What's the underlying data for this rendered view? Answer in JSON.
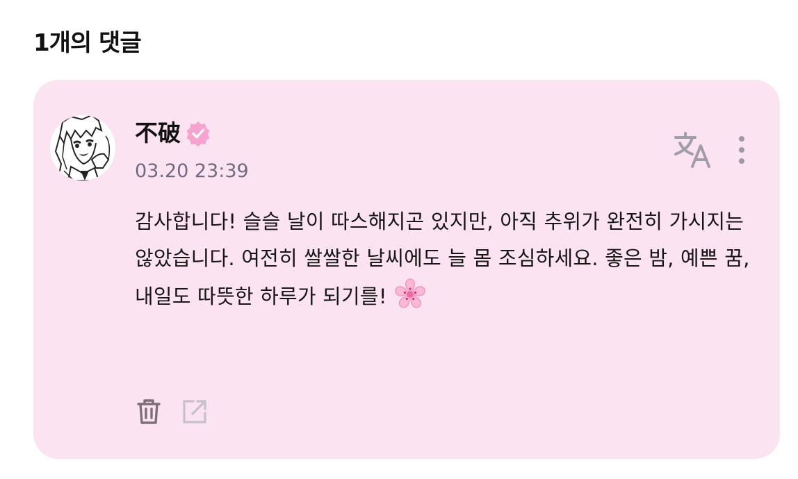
{
  "section": {
    "title": "1개의 댓글"
  },
  "comment": {
    "author": "不破",
    "verified": true,
    "timestamp": "03.20 23:39",
    "text": "감사합니다! 슬슬 날이 따스해지곤 있지만, 아직 추위가 완전히 가시지는 않았습니다. 여전히 쌀쌀한 날씨에도 늘 몸 조심하세요. 좋은 밤, 예쁜 꿈, 내일도 따뜻한 하루가 되기를!",
    "emoji": "cherry-blossom"
  },
  "icons": {
    "avatar": "manga-character-avatar",
    "verified": "verified-badge-icon",
    "translate": "translate-icon",
    "more": "more-vertical-icon",
    "delete": "trash-icon",
    "share": "share-external-icon"
  },
  "colors": {
    "card_background": "#fce3f1",
    "verified_badge": "#f7a2cf",
    "muted_icon": "#9a98a6",
    "timestamp": "#6f6a80"
  }
}
